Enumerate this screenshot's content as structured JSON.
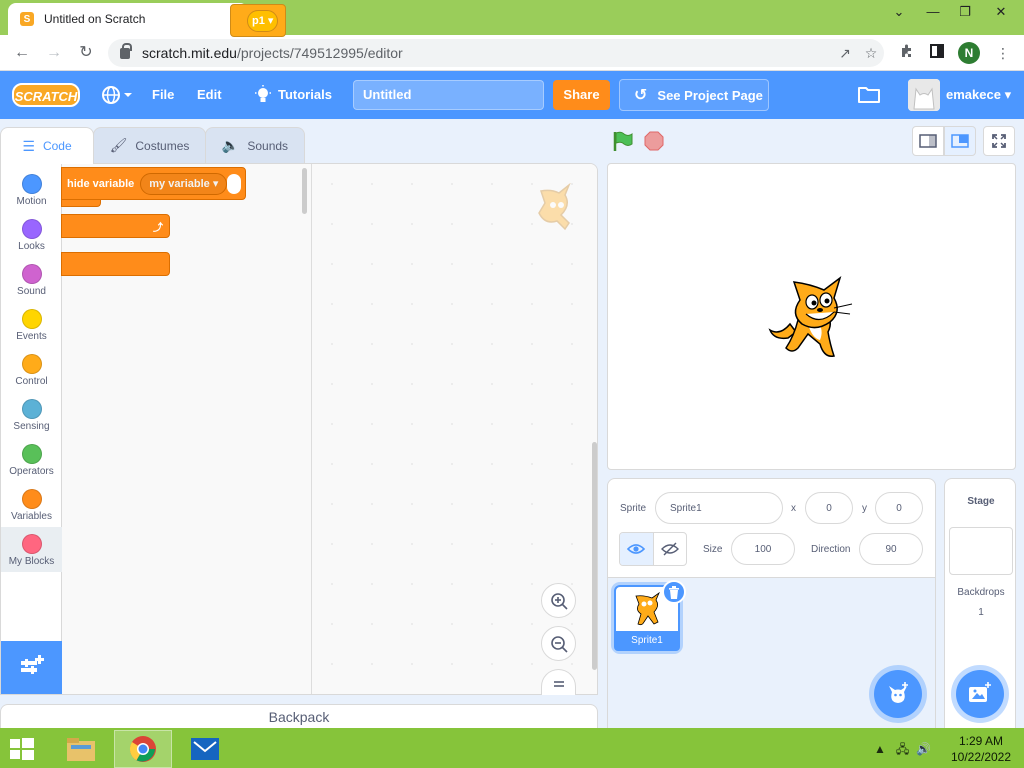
{
  "browser": {
    "tab_title": "Untitled on Scratch",
    "tab_close": "✕",
    "new_tab": "+",
    "url_host": "scratch.mit.edu",
    "url_path": "/projects/749512995/editor",
    "profile_initial": "N",
    "window_controls": [
      "⌄",
      "—",
      "❐",
      "✕"
    ]
  },
  "menubar": {
    "logo": "SCRATCH",
    "file": "File",
    "edit": "Edit",
    "tutorials": "Tutorials",
    "project_title": "Untitled",
    "share": "Share",
    "see_project_page": "See Project Page",
    "username": "emakece",
    "accent": "#4c97ff"
  },
  "editor_tabs": [
    {
      "label": "Code",
      "active": true
    },
    {
      "label": "Costumes",
      "active": false
    },
    {
      "label": "Sounds",
      "active": false
    }
  ],
  "categories": [
    {
      "label": "Motion",
      "color": "#4c97ff"
    },
    {
      "label": "Looks",
      "color": "#9966ff"
    },
    {
      "label": "Sound",
      "color": "#cf63cf"
    },
    {
      "label": "Events",
      "color": "#ffd500"
    },
    {
      "label": "Control",
      "color": "#ffab19"
    },
    {
      "label": "Sensing",
      "color": "#5cb1d6"
    },
    {
      "label": "Operators",
      "color": "#59c059"
    },
    {
      "label": "Variables",
      "color": "#ff8c1a"
    },
    {
      "label": "My Blocks",
      "color": "#ff6680"
    }
  ],
  "blocks": {
    "hide_variable": "hide variable",
    "variable_dropdown": "my variable",
    "behind_dropdown": "p1"
  },
  "backpack": "Backpack",
  "sprite_info": {
    "sprite_label": "Sprite",
    "sprite_name": "Sprite1",
    "x_label": "x",
    "x_value": "0",
    "y_label": "y",
    "y_value": "0",
    "size_label": "Size",
    "size_value": "100",
    "direction_label": "Direction",
    "direction_value": "90"
  },
  "sprites": [
    {
      "name": "Sprite1",
      "selected": true
    }
  ],
  "stage_target": {
    "header": "Stage",
    "backdrops_label": "Backdrops",
    "backdrops_count": "1"
  },
  "taskbar": {
    "time": "1:29 AM",
    "date": "10/22/2022"
  }
}
